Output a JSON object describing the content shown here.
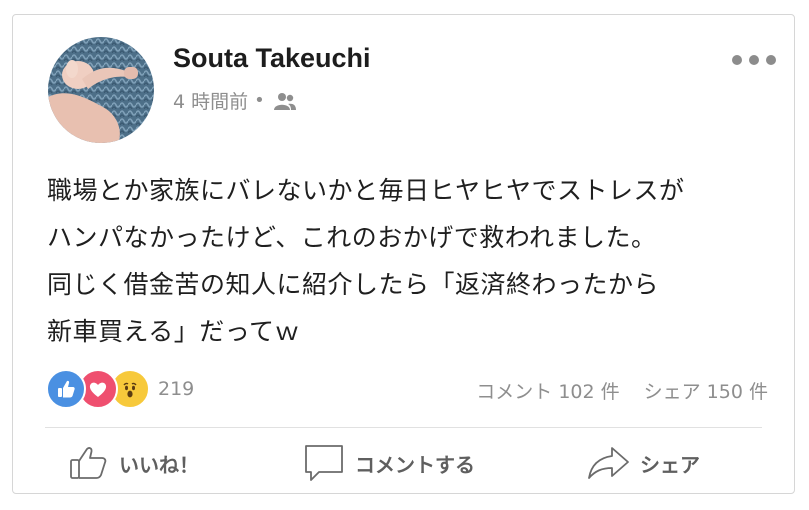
{
  "post": {
    "author_name": "Souta Takeuchi",
    "timestamp": "4 時間前",
    "separator": "•",
    "audience_icon": "friends-icon",
    "more_icon": "more-options-icon",
    "lines": [
      "職場とか家族にバレないかと毎日ヒヤヒヤでストレスが",
      "ハンパなかったけど、これのおかげで救われました。",
      "同じく借金苦の知人に紹介したら「返済終わったから",
      "新車買える」だってｗ"
    ]
  },
  "stats": {
    "reaction_icons": [
      "like-reaction-icon",
      "love-reaction-icon",
      "wow-reaction-icon"
    ],
    "reaction_count": "219",
    "comments": "コメント 102 件",
    "shares": "シェア 150 件"
  },
  "actions": {
    "like_label": "いいね！",
    "comment_label": "コメントする",
    "share_label": "シェア"
  },
  "colors": {
    "like": "#4a90e2",
    "love": "#ef4f6f",
    "wow": "#f7c93b",
    "text": "#1f1f1f",
    "muted": "#8e8e8e"
  }
}
